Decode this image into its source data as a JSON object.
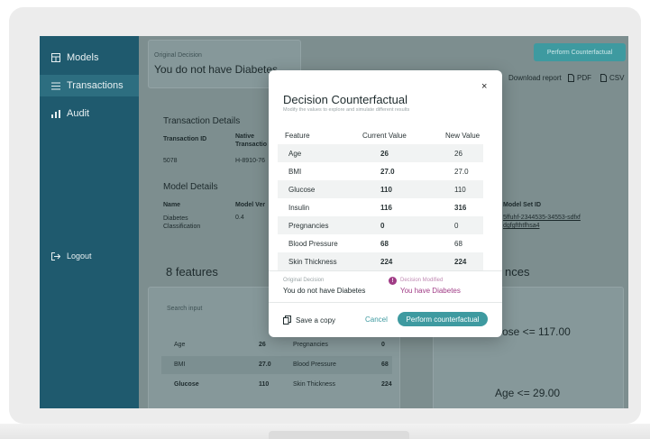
{
  "sidebar": {
    "items": [
      {
        "label": "Models",
        "icon": "grid-icon"
      },
      {
        "label": "Transactions",
        "icon": "list-icon"
      },
      {
        "label": "Audit",
        "icon": "bar-chart-icon"
      }
    ],
    "logout": "Logout"
  },
  "header": {
    "original_decision_label": "Original Decision",
    "original_decision_value": "You do not have Diabetes",
    "perform_button": "Perform Counterfactual",
    "download_report": "Download report",
    "pdf": "PDF",
    "csv": "CSV"
  },
  "transaction": {
    "title": "Transaction Details",
    "col_id": "Transaction ID",
    "col_native": "Native Transactio",
    "id_value": "5078",
    "native_value": "H-8910-76"
  },
  "model": {
    "title": "Model Details",
    "col_name": "Name",
    "col_version": "Model Ver",
    "name_value": "Diabetes Classification",
    "version_value": "0.4",
    "set_id_label": "Model Set ID",
    "set_id_value_1": "5ffuhf-2344535-34553-sdfxf",
    "set_id_value_2": "dgfgfthtfhsa4"
  },
  "features": {
    "title": "8 features",
    "search_placeholder": "Search input",
    "rows": [
      {
        "left_name": "Age",
        "left_value": "26",
        "right_name": "Pregnancies",
        "right_value": "0"
      },
      {
        "left_name": "BMI",
        "left_value": "27.0",
        "right_name": "Blood Pressure",
        "right_value": "68"
      },
      {
        "left_name": "Glucose",
        "left_value": "110",
        "right_name": "Skin Thickness",
        "right_value": "224"
      }
    ]
  },
  "influences": {
    "title_fragment": "nces",
    "rule_1": "cose <= 117.00",
    "rule_2": "Age <= 29.00"
  },
  "modal": {
    "title": "Decision Counterfactual",
    "subtitle": "Modify the values to explore and simulate different results",
    "close": "×",
    "headers": {
      "feature": "Feature",
      "current": "Current Value",
      "new": "New Value"
    },
    "rows": [
      {
        "feature": "Age",
        "current": "26",
        "new": "26",
        "changed": false
      },
      {
        "feature": "BMI",
        "current": "27.0",
        "new": "27.0",
        "changed": false
      },
      {
        "feature": "Glucose",
        "current": "110",
        "new": "110",
        "changed": false
      },
      {
        "feature": "Insulin",
        "current": "116",
        "new": "316",
        "changed": true
      },
      {
        "feature": "Pregnancies",
        "current": "0",
        "new": "0",
        "changed": false
      },
      {
        "feature": "Blood Pressure",
        "current": "68",
        "new": "68",
        "changed": false
      },
      {
        "feature": "Skin Thickness",
        "current": "224",
        "new": "224",
        "changed": true
      }
    ],
    "original_label": "Original Decision",
    "original_value": "You do not have Diabetes",
    "modified_label": "Decision Modified",
    "modified_value": "You have Diabetes",
    "save": "Save a copy",
    "cancel": "Cancel",
    "perform": "Perform counterfactual"
  },
  "colors": {
    "sidebar": "#1f5a6e",
    "accent": "#3e9aa0",
    "modified": "#a03c86"
  }
}
